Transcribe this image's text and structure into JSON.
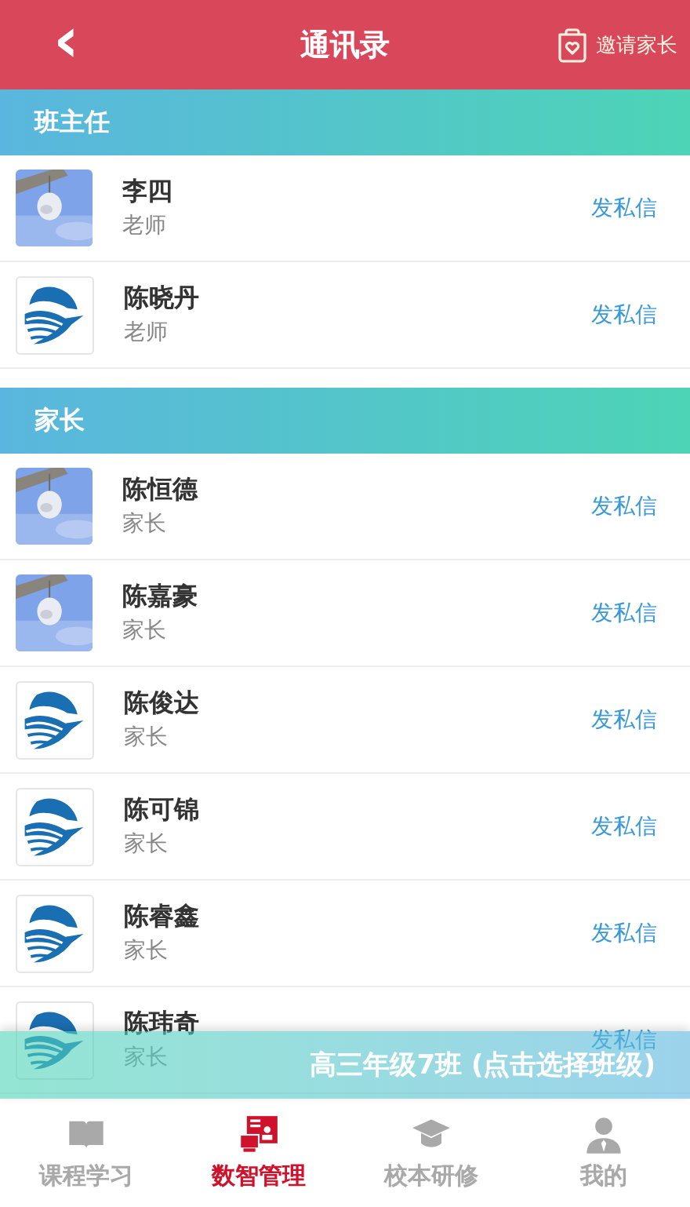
{
  "header": {
    "back_icon": "‹",
    "title": "通讯录",
    "invite": "邀请家长"
  },
  "sections": [
    {
      "title": "班主任",
      "contacts": [
        {
          "name": "李四",
          "role": "老师",
          "action": "发私信"
        },
        {
          "name": "陈晓丹",
          "role": "老师",
          "action": "发私信",
          "kind": "logo"
        }
      ]
    },
    {
      "title": "家长",
      "contacts": [
        {
          "name": "陈恒德",
          "role": "家长",
          "action": "发私信"
        },
        {
          "name": "陈嘉豪",
          "role": "家长",
          "action": "发私信"
        },
        {
          "name": "陈俊达",
          "role": "家长",
          "action": "发私信",
          "kind": "logo"
        },
        {
          "name": "陈可锦",
          "role": "家长",
          "action": "发私信",
          "kind": "logo"
        },
        {
          "name": "陈睿鑫",
          "role": "家长",
          "action": "发私信",
          "kind": "logo"
        },
        {
          "name": "陈玮奇",
          "role": "家长",
          "action": "发私信",
          "kind": "logo"
        }
      ]
    }
  ],
  "class_banner": "高三年级7班 (点击选择班级)",
  "tabs": [
    {
      "label": "课程学习",
      "selected": false
    },
    {
      "label": "数智管理",
      "selected": true
    },
    {
      "label": "校本研修",
      "selected": false
    },
    {
      "label": "我的",
      "selected": false
    }
  ]
}
